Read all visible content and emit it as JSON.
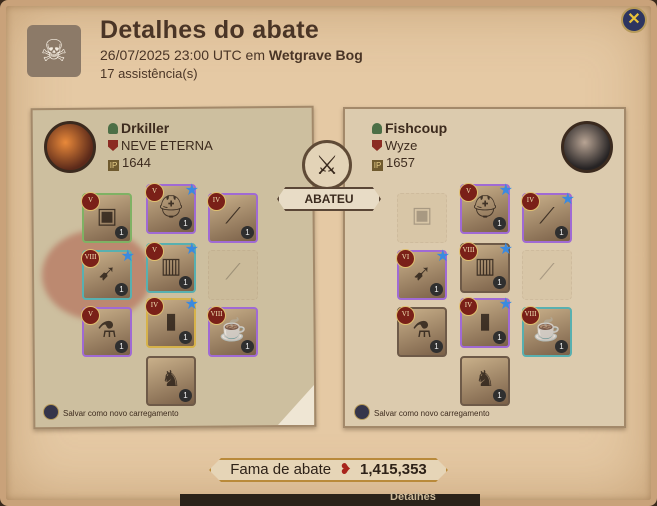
{
  "header": {
    "title": "Detalhes do abate",
    "timestamp": "26/07/2025 23:00 UTC em",
    "location": "Wetgrave Bog",
    "assists": "17 assistência(s)"
  },
  "close_label": "✕",
  "killer": {
    "name": "Drkiller",
    "guild": "NEVE ETERNA",
    "ip": "1644",
    "loadout_text": "Salvar como novo carregamento"
  },
  "victim": {
    "name": "Fishcoup",
    "guild": "Wyze",
    "ip": "1657",
    "loadout_text": "Salvar como novo carregamento"
  },
  "center_label": "ABATEU",
  "fame": {
    "label": "Fama de abate",
    "value": "1,415,353"
  },
  "bottom_text": "Detalhes",
  "killer_slots": [
    {
      "tier": "V",
      "qty": "1",
      "quality": "green",
      "icon": "bag-icon"
    },
    {
      "tier": "V",
      "qty": "1",
      "quality": "purple",
      "icon": "helmet-icon",
      "star": true
    },
    {
      "tier": "IV",
      "qty": "1",
      "quality": "purple",
      "icon": "cape-icon"
    },
    {
      "tier": "VIII",
      "qty": "1",
      "quality": "teal",
      "icon": "crossbow-icon",
      "star": true
    },
    {
      "tier": "V",
      "qty": "1",
      "quality": "teal",
      "icon": "armor-icon",
      "star": true
    },
    {
      "tier": "",
      "qty": "",
      "quality": "none",
      "icon": "offhand-ghost-icon",
      "ghost": true
    },
    {
      "tier": "V",
      "qty": "1",
      "quality": "purple",
      "icon": "potion-icon"
    },
    {
      "tier": "IV",
      "qty": "1",
      "quality": "gold",
      "icon": "boots-icon",
      "star": true
    },
    {
      "tier": "VIII",
      "qty": "1",
      "quality": "purple",
      "icon": "food-icon"
    },
    {
      "tier": "",
      "qty": "1",
      "quality": "none",
      "icon": "mount-icon"
    }
  ],
  "victim_slots": [
    {
      "tier": "",
      "qty": "",
      "quality": "none",
      "icon": "bag-ghost-icon",
      "ghost": true
    },
    {
      "tier": "V",
      "qty": "1",
      "quality": "purple",
      "icon": "helmet-icon",
      "star": true
    },
    {
      "tier": "IV",
      "qty": "1",
      "quality": "purple",
      "icon": "cape-icon",
      "star": true
    },
    {
      "tier": "VI",
      "qty": "1",
      "quality": "purple",
      "icon": "crossbow-icon",
      "star": true
    },
    {
      "tier": "VIII",
      "qty": "1",
      "quality": "none",
      "icon": "armor-icon",
      "star": true
    },
    {
      "tier": "",
      "qty": "",
      "quality": "none",
      "icon": "offhand-ghost-icon",
      "ghost": true
    },
    {
      "tier": "VI",
      "qty": "1",
      "quality": "none",
      "icon": "potion-icon"
    },
    {
      "tier": "IV",
      "qty": "1",
      "quality": "purple",
      "icon": "boots-icon",
      "star": true
    },
    {
      "tier": "VIII",
      "qty": "1",
      "quality": "teal",
      "icon": "food-icon"
    },
    {
      "tier": "",
      "qty": "1",
      "quality": "none",
      "icon": "mount-icon"
    }
  ]
}
